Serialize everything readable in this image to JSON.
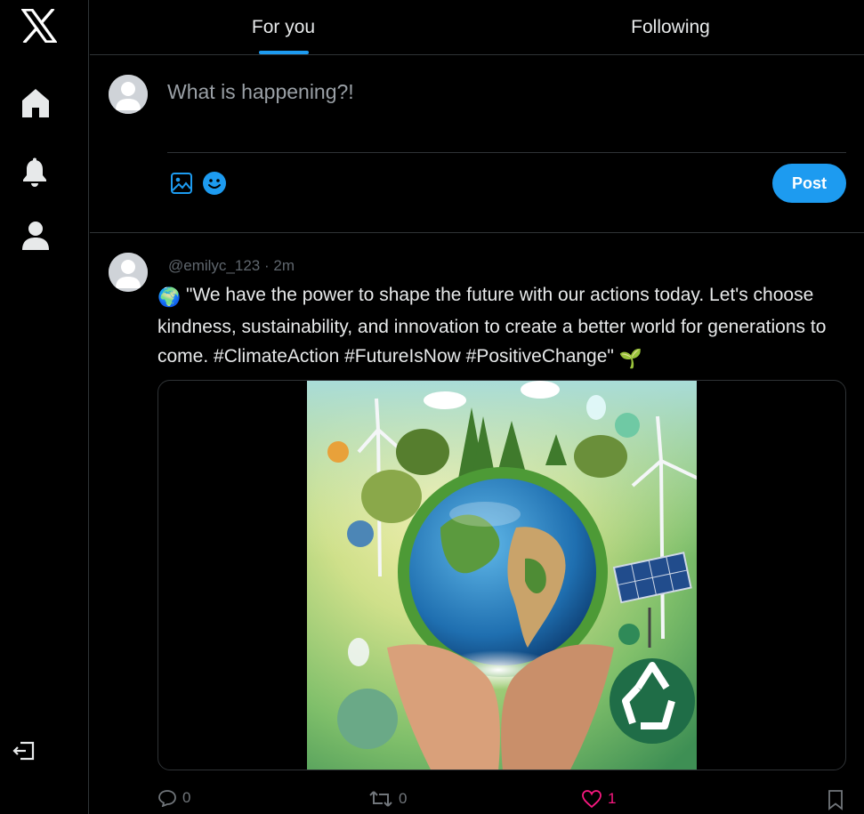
{
  "sidebar": {
    "logo": "x-logo-icon",
    "items": [
      {
        "icon": "home-icon"
      },
      {
        "icon": "bell-icon"
      },
      {
        "icon": "profile-icon"
      }
    ],
    "logout_icon": "logout-icon"
  },
  "tabs": [
    {
      "label": "For you",
      "active": true
    },
    {
      "label": "Following",
      "active": false
    }
  ],
  "composer": {
    "placeholder": "What is happening?!",
    "tools": [
      "image-icon",
      "emoji-icon"
    ],
    "post_label": "Post"
  },
  "tweet": {
    "handle": "@emilyc_123",
    "separator": "·",
    "time": "2m",
    "leading_emoji": "🌍",
    "text": "\"We have the power to shape the future with our actions today. Let's choose kindness, sustainability, and innovation to create a better world for generations to come. #ClimateAction #FutureIsNow #PositiveChange\"",
    "trailing_emoji": "🌱",
    "image_description_icon": "earth-in-hands-image",
    "actions": {
      "replies": "0",
      "retweets": "0",
      "likes": "1"
    }
  },
  "colors": {
    "accent": "#1d9bf0",
    "like": "#f91880",
    "background": "#000000",
    "border": "#2f3336",
    "text": "#e7e9ea",
    "muted": "#71767b"
  }
}
